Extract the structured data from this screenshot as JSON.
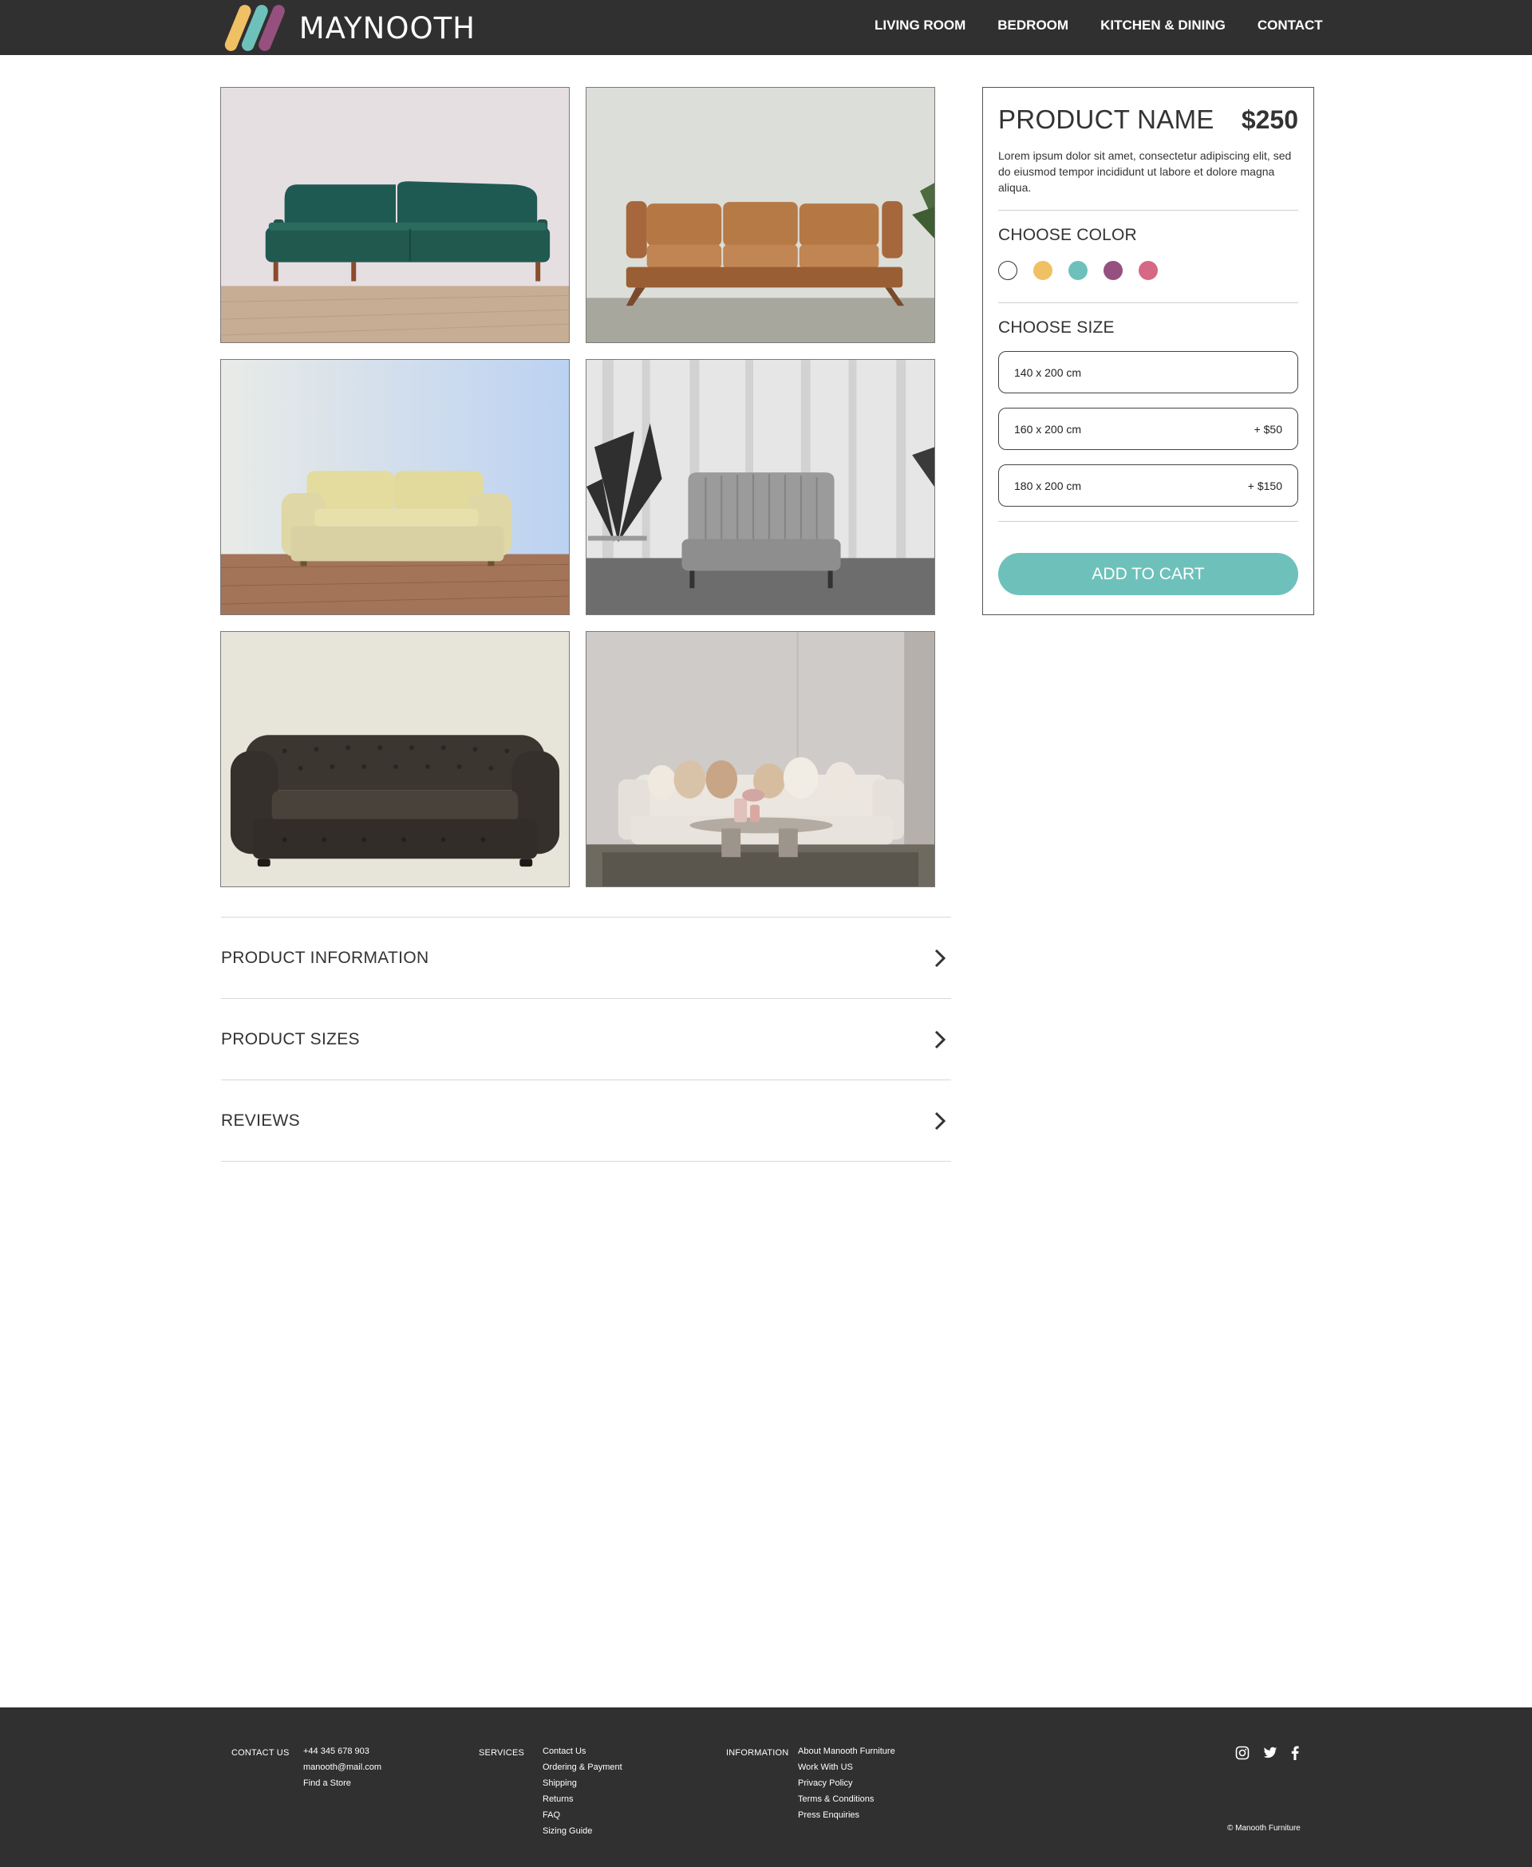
{
  "header": {
    "logo_text": "MAYNOOTH",
    "nav": [
      "LIVING ROOM",
      "BEDROOM",
      "KITCHEN & DINING",
      "CONTACT"
    ]
  },
  "gallery": {
    "images": [
      "green-velvet-sofa",
      "tan-leather-sofa",
      "cream-leather-sofa",
      "grey-channel-sofa",
      "dark-chesterfield-sofa",
      "white-sofa-living-room"
    ]
  },
  "accordion": {
    "items": [
      "PRODUCT INFORMATION",
      "PRODUCT SIZES",
      "REVIEWS"
    ]
  },
  "product": {
    "name": "PRODUCT NAME",
    "price": "$250",
    "description": "Lorem ipsum dolor sit amet, consectetur adipiscing elit, sed do eiusmod tempor incididunt ut labore et dolore magna aliqua.",
    "choose_color_label": "CHOOSE COLOR",
    "colors": [
      "#ffffff",
      "#f0c064",
      "#6ec1bb",
      "#96507f",
      "#d66886"
    ],
    "choose_size_label": "CHOOSE SIZE",
    "sizes": [
      {
        "label": "140 x 200 cm",
        "extra": ""
      },
      {
        "label": "160 x 200 cm",
        "extra": "+ $50"
      },
      {
        "label": "180 x 200 cm",
        "extra": "+ $150"
      }
    ],
    "add_to_cart": "ADD TO CART"
  },
  "footer": {
    "contact_title": "CONTACT US",
    "contact_items": [
      "+44 345 678 903",
      "manooth@mail.com",
      "Find a Store"
    ],
    "services_title": "SERVICES",
    "services_items": [
      "Contact Us",
      "Ordering & Payment",
      "Shipping",
      "Returns",
      "FAQ",
      "Sizing Guide"
    ],
    "information_title": "INFORMATION",
    "information_items": [
      "About Manooth Furniture",
      "Work With US",
      "Privacy Policy",
      "Terms & Conditions",
      "Press Enquiries"
    ],
    "social_icons": [
      "instagram-icon",
      "twitter-icon",
      "facebook-icon"
    ],
    "copyright": "© Manooth Furniture"
  },
  "colors": {
    "header_bg": "#303030",
    "accent": "#6ec1bb",
    "logo_stripes": [
      "#f0c064",
      "#6ec1bb",
      "#96507f"
    ]
  }
}
